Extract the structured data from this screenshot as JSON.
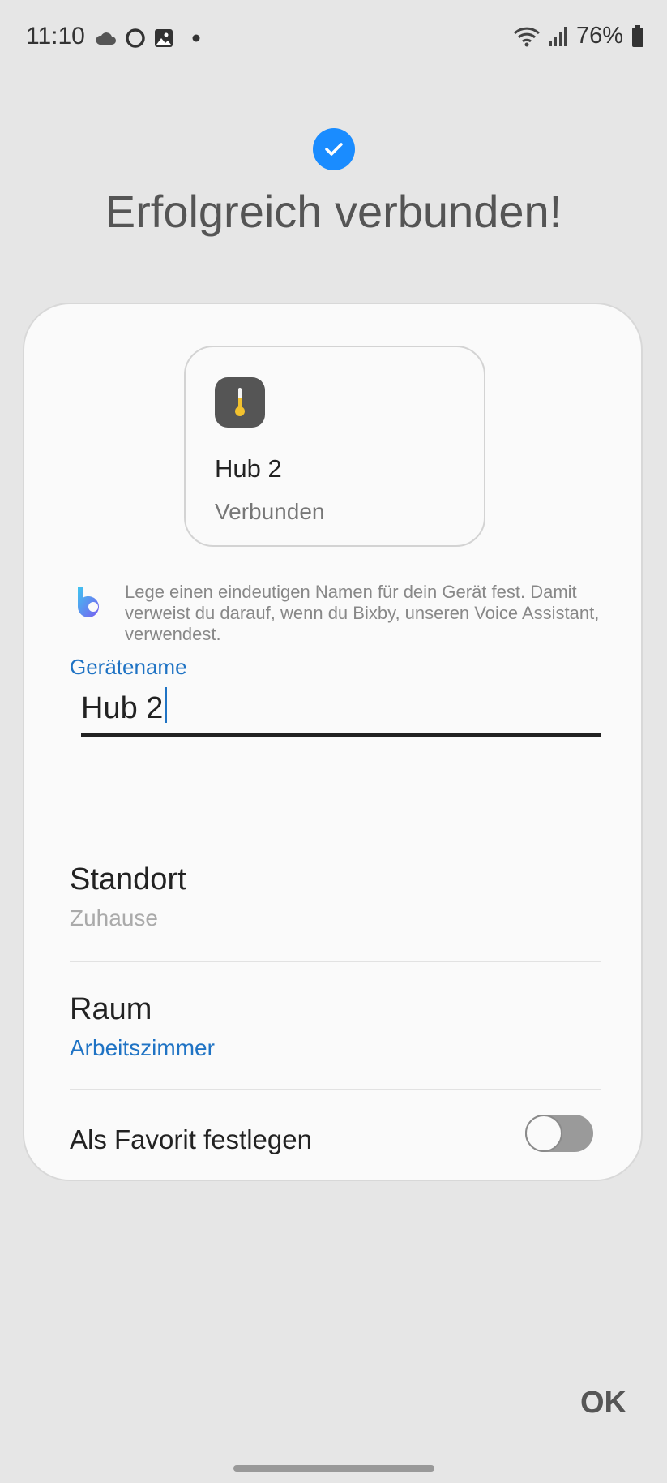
{
  "status_bar": {
    "time": "11:10",
    "battery": "76%",
    "icons": [
      "cloud-icon",
      "circle-icon",
      "gallery-icon",
      "dot-icon",
      "wifi-icon",
      "signal-icon",
      "battery-icon"
    ]
  },
  "header": {
    "title": "Erfolgreich verbunden!",
    "accent_color": "#1a8cff"
  },
  "device": {
    "name": "Hub 2",
    "status": "Verbunden",
    "icon": "thermometer-icon"
  },
  "bixby_hint": "Lege einen eindeutigen Namen für dein Gerät fest. Damit verweist du darauf, wenn du Bixby, unseren Voice Assistant, verwendest.",
  "name_field": {
    "label": "Gerätename",
    "value": "Hub 2"
  },
  "location": {
    "title": "Standort",
    "value": "Zuhause"
  },
  "room": {
    "title": "Raum",
    "value": "Arbeitszimmer"
  },
  "favorite": {
    "label": "Als Favorit festlegen",
    "enabled": false
  },
  "ok_label": "OK",
  "colors": {
    "link": "#1f73c4",
    "muted": "#aaaaaa"
  }
}
